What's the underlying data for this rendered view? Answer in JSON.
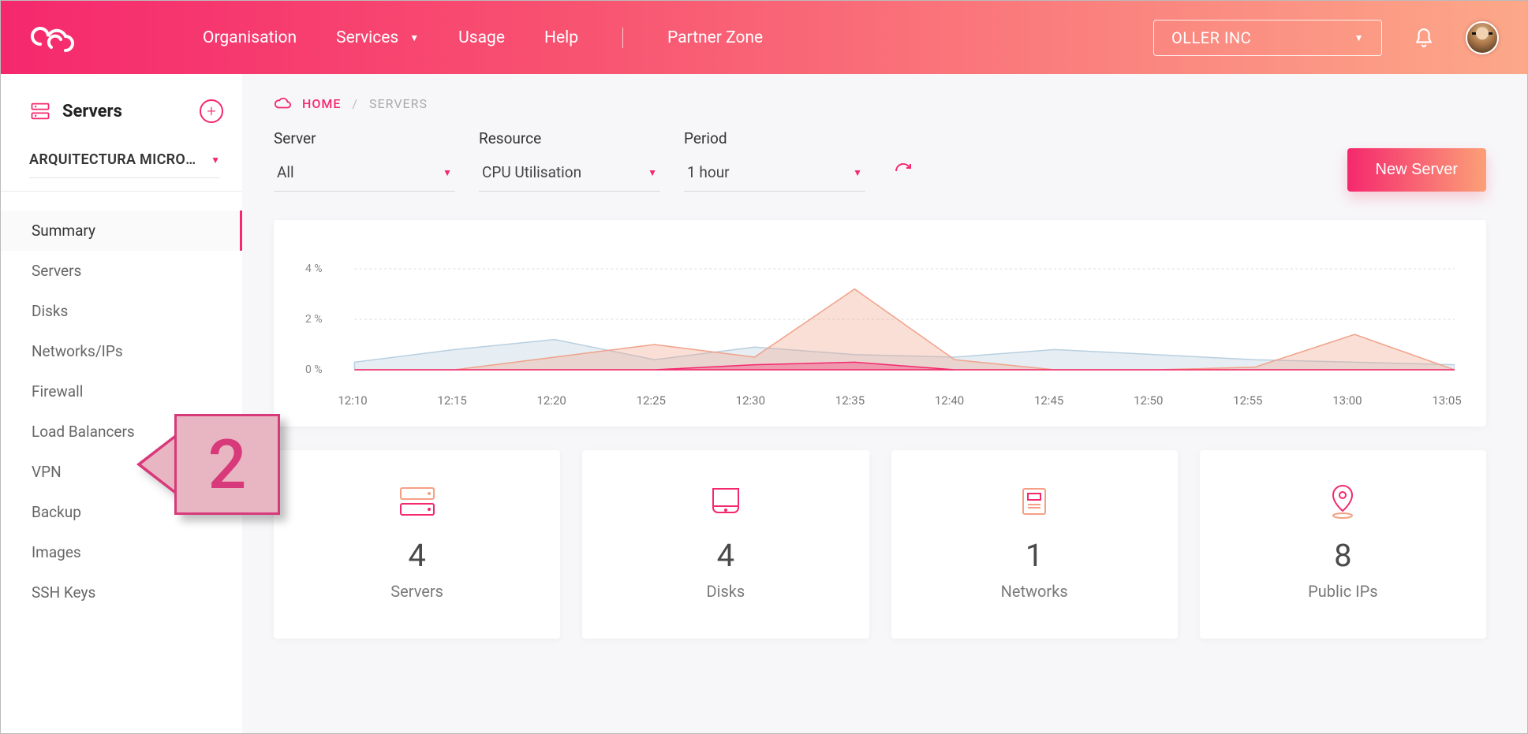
{
  "header": {
    "nav": [
      "Organisation",
      "Services",
      "Usage",
      "Help",
      "Partner Zone"
    ],
    "org_selected": "OLLER INC"
  },
  "sidebar": {
    "title": "Servers",
    "project": "ARQUITECTURA MICROS…",
    "items": [
      "Summary",
      "Servers",
      "Disks",
      "Networks/IPs",
      "Firewall",
      "Load Balancers",
      "VPN",
      "Backup",
      "Images",
      "SSH Keys"
    ],
    "active_index": 0
  },
  "breadcrumb": {
    "home": "HOME",
    "current": "SERVERS"
  },
  "filters": {
    "server": {
      "label": "Server",
      "value": "All"
    },
    "resource": {
      "label": "Resource",
      "value": "CPU Utilisation"
    },
    "period": {
      "label": "Period",
      "value": "1 hour"
    }
  },
  "actions": {
    "new_server": "New Server"
  },
  "stats": [
    {
      "icon": "servers",
      "value": "4",
      "label": "Servers"
    },
    {
      "icon": "disks",
      "value": "4",
      "label": "Disks"
    },
    {
      "icon": "networks",
      "value": "1",
      "label": "Networks"
    },
    {
      "icon": "publicips",
      "value": "8",
      "label": "Public IPs"
    }
  ],
  "annotation": {
    "number": "2"
  },
  "chart_data": {
    "type": "area",
    "title": "",
    "xlabel": "",
    "ylabel": "",
    "ylim": [
      0,
      4
    ],
    "yunit": "%",
    "yticks": [
      0,
      2,
      4
    ],
    "x": [
      "12:10",
      "12:15",
      "12:20",
      "12:25",
      "12:30",
      "12:35",
      "12:40",
      "12:45",
      "12:50",
      "12:55",
      "13:00",
      "13:05"
    ],
    "series": [
      {
        "name": "blue",
        "color": "#b8cfe0",
        "values": [
          0.3,
          0.8,
          1.2,
          0.4,
          0.9,
          0.6,
          0.5,
          0.8,
          0.6,
          0.4,
          0.3,
          0.2
        ]
      },
      {
        "name": "orange",
        "color": "#f0a28a",
        "values": [
          0.0,
          0.0,
          0.5,
          1.0,
          0.5,
          3.2,
          0.4,
          0.0,
          0.0,
          0.1,
          1.4,
          0.0
        ]
      },
      {
        "name": "pink",
        "color": "#f5286e",
        "values": [
          0.0,
          0.0,
          0.0,
          0.0,
          0.2,
          0.3,
          0.0,
          0.0,
          0.0,
          0.0,
          0.0,
          0.0
        ]
      }
    ]
  }
}
